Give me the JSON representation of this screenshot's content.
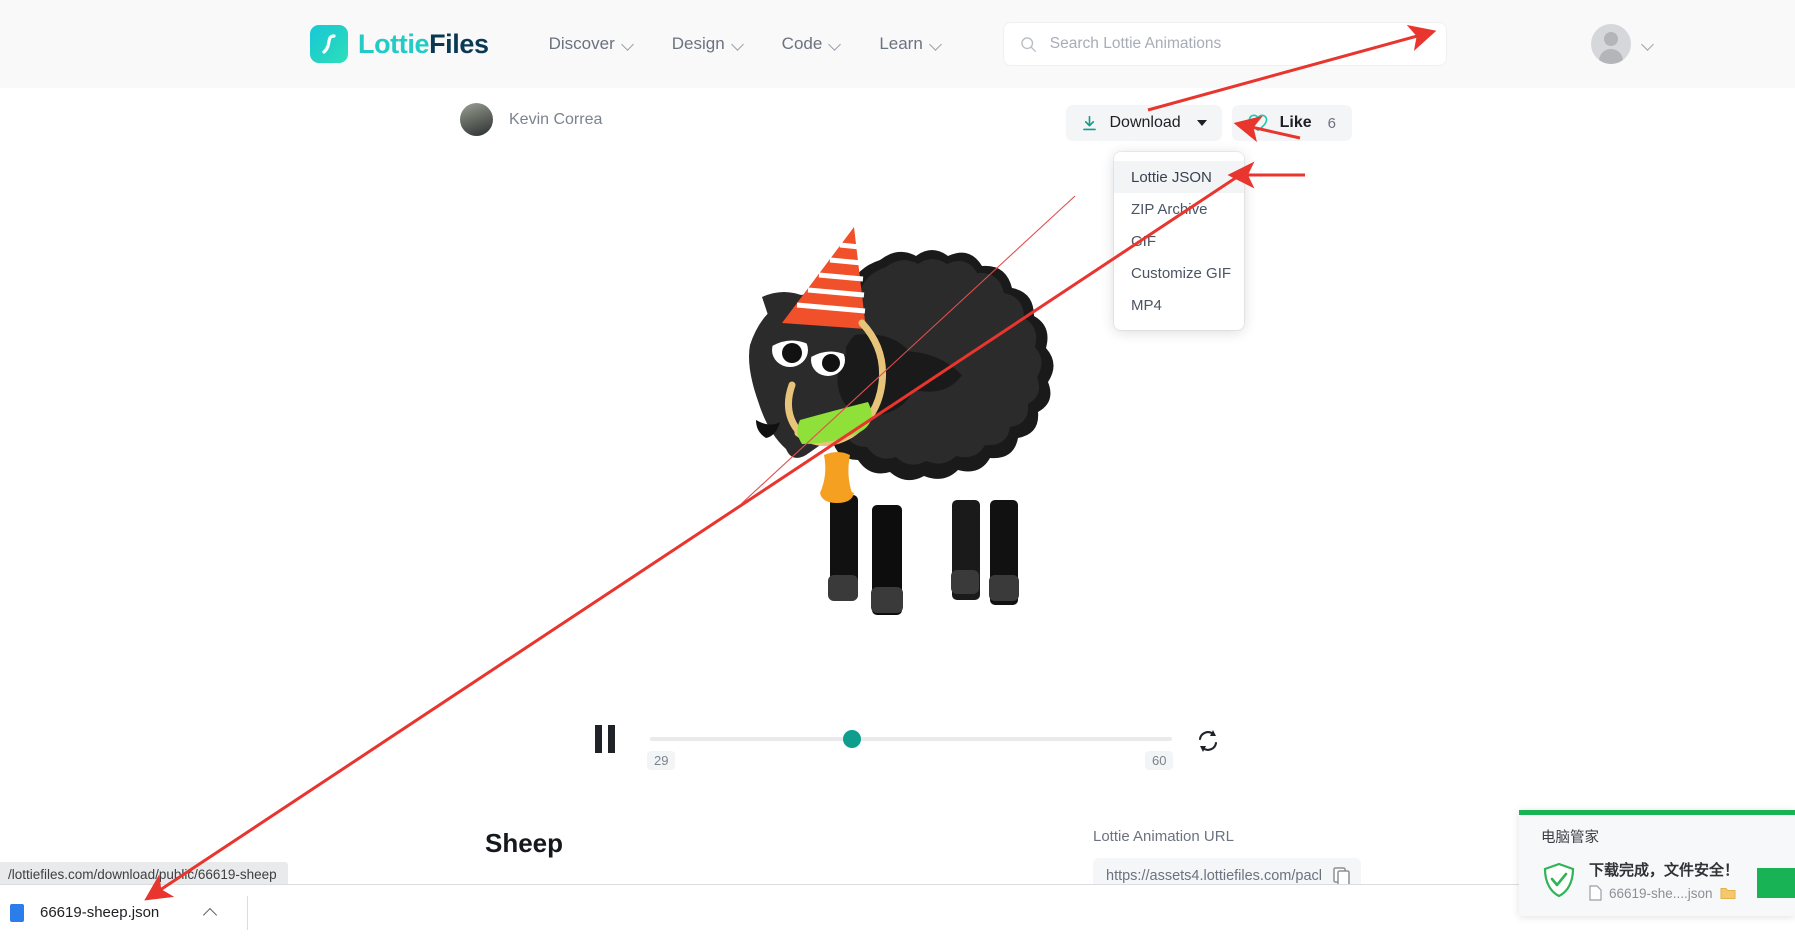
{
  "header": {
    "logo_text_part1": "Lottie",
    "logo_text_part2": "Files",
    "nav": [
      {
        "label": "Discover",
        "icon": "chevron-down-icon"
      },
      {
        "label": "Design",
        "icon": "chevron-down-icon"
      },
      {
        "label": "Code",
        "icon": "chevron-down-icon"
      },
      {
        "label": "Learn",
        "icon": "chevron-down-icon"
      }
    ],
    "search": {
      "placeholder": "Search Lottie Animations",
      "icon": "search-icon"
    },
    "account": {
      "avatar": "user-avatar-icon",
      "caret": "chevron-down-icon"
    }
  },
  "author": {
    "name": "Kevin Correa",
    "avatar": "author-avatar"
  },
  "actions": {
    "download_label": "Download",
    "download_icon": "download-icon",
    "like_label": "Like",
    "like_icon": "heart-icon",
    "like_count": "6"
  },
  "download_menu": {
    "items": [
      {
        "label": "Lottie JSON",
        "active": true
      },
      {
        "label": "ZIP Archive",
        "active": false
      },
      {
        "label": "GIF",
        "active": false
      },
      {
        "label": "Customize GIF",
        "active": false
      },
      {
        "label": "MP4",
        "active": false
      }
    ]
  },
  "player": {
    "pause_icon": "pause-icon",
    "loop_icon": "loop-icon",
    "current_frame": "29",
    "total_frames": "60",
    "progress_percent": 48
  },
  "animation": {
    "title": "Sheep",
    "artwork": "black-sheep-with-party-hat-illustration"
  },
  "url_section": {
    "label": "Lottie Animation URL",
    "value": "https://assets4.lottiefiles.com/pacl",
    "copy_icon": "copy-icon"
  },
  "browser": {
    "status_url": "/lottiefiles.com/download/public/66619-sheep",
    "download_filename": "66619-sheep.json",
    "download_chevron": "chevron-up-icon"
  },
  "toast": {
    "title": "电脑管家",
    "message": "下载完成，文件安全！",
    "filename": "66619-she....json",
    "shield_icon": "shield-check-icon",
    "folder_icon": "folder-icon",
    "file_icon": "file-icon"
  },
  "colors": {
    "brand_teal": "#24cbc6",
    "brand_dark": "#0b3954",
    "accent_green": "#0e9e8e",
    "toast_green": "#17b354",
    "annotation_red": "#e8352e",
    "hat_red": "#f0512a",
    "bell_orange": "#f5a020",
    "collar_green": "#8fe038"
  }
}
